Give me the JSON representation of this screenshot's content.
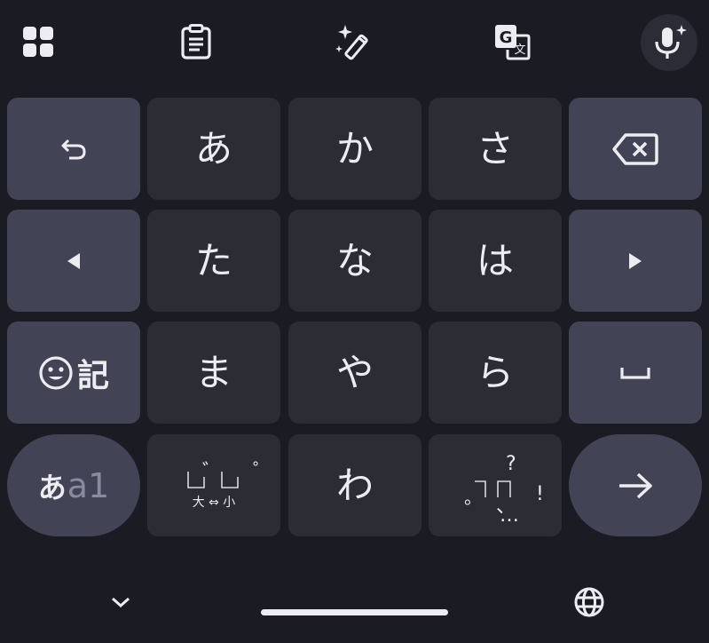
{
  "toolbar": {
    "icons": [
      "apps-grid-icon",
      "clipboard-icon",
      "magic-wand-icon",
      "translate-icon",
      "voice-input-icon"
    ]
  },
  "keyboard": {
    "row1": {
      "kana1": "あ",
      "kana2": "か",
      "kana3": "さ"
    },
    "row2": {
      "kana1": "た",
      "kana2": "な",
      "kana3": "は"
    },
    "row3": {
      "symbol_label": "記",
      "kana1": "ま",
      "kana2": "や",
      "kana3": "ら"
    },
    "row4": {
      "mode_kana": "あ",
      "mode_alpha": "a1",
      "dakuten_marks": "゛ ゜",
      "size_label": "大 ⇔ 小",
      "kana_wa": "わ",
      "punct_question": "?",
      "punct_exclaim": "!",
      "punct_comma": "、",
      "punct_period": "。",
      "punct_ellipsis": "…"
    }
  },
  "colors": {
    "background": "#1b1b24",
    "key": "#2c2c34",
    "function_key": "#434356",
    "text": "#ececf2"
  }
}
